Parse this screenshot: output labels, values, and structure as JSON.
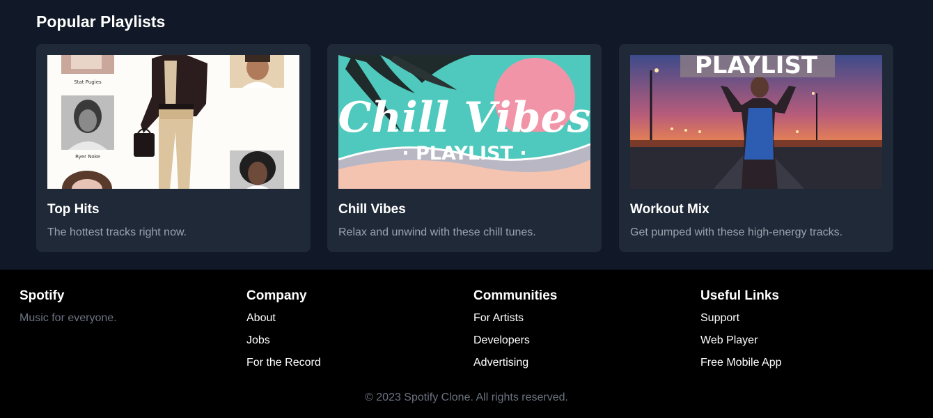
{
  "popular": {
    "title": "Popular Playlists",
    "playlists": [
      {
        "title": "Top Hits",
        "description": "The hottest tracks right now.",
        "image_texts": [
          "Stat Pugies",
          "Ryer Noke"
        ]
      },
      {
        "title": "Chill Vibes",
        "description": "Relax and unwind with these chill tunes.",
        "image_texts": [
          "Chill Vibes",
          "· PLAYLIST ·"
        ]
      },
      {
        "title": "Workout Mix",
        "description": "Get pumped with these high-energy tracks.",
        "image_texts": [
          "PLAYLIST"
        ]
      }
    ]
  },
  "footer": {
    "brand": {
      "title": "Spotify",
      "tagline": "Music for everyone."
    },
    "columns": [
      {
        "title": "Company",
        "links": [
          "About",
          "Jobs",
          "For the Record"
        ]
      },
      {
        "title": "Communities",
        "links": [
          "For Artists",
          "Developers",
          "Advertising"
        ]
      },
      {
        "title": "Useful Links",
        "links": [
          "Support",
          "Web Player",
          "Free Mobile App"
        ]
      }
    ],
    "copyright": "© 2023 Spotify Clone. All rights reserved."
  },
  "colors": {
    "page_bg": "#111827",
    "card_bg": "#1f2937",
    "footer_bg": "#000000",
    "muted_text": "#9ca3af"
  }
}
